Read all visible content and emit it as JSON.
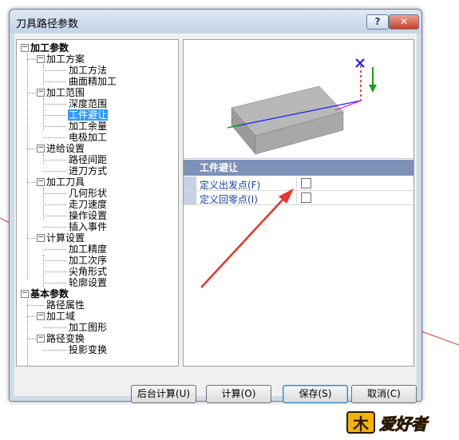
{
  "window": {
    "title": "刀具路径参数",
    "help_label": "?",
    "close_label": "✕"
  },
  "tree": {
    "items": [
      {
        "label": "加工参数",
        "level": 0,
        "bold": true,
        "expander": "⊟"
      },
      {
        "label": "加工方案",
        "level": 1,
        "expander": "⊟"
      },
      {
        "label": "加工方法",
        "level": 2
      },
      {
        "label": "曲面精加工",
        "level": 2
      },
      {
        "label": "加工范围",
        "level": 1,
        "expander": "⊟"
      },
      {
        "label": "深度范围",
        "level": 2
      },
      {
        "label": "工件避让",
        "level": 2,
        "selected": true
      },
      {
        "label": "加工余量",
        "level": 2
      },
      {
        "label": "电极加工",
        "level": 2
      },
      {
        "label": "进给设置",
        "level": 1,
        "expander": "⊟"
      },
      {
        "label": "路径间距",
        "level": 2
      },
      {
        "label": "进刀方式",
        "level": 2
      },
      {
        "label": "加工刀具",
        "level": 1,
        "expander": "⊟"
      },
      {
        "label": "几何形状",
        "level": 2
      },
      {
        "label": "走刀速度",
        "level": 2
      },
      {
        "label": "操作设置",
        "level": 2
      },
      {
        "label": "插入事件",
        "level": 2
      },
      {
        "label": "计算设置",
        "level": 1,
        "expander": "⊟"
      },
      {
        "label": "加工精度",
        "level": 2
      },
      {
        "label": "加工次序",
        "level": 2
      },
      {
        "label": "尖角形式",
        "level": 2
      },
      {
        "label": "轮廓设置",
        "level": 2
      },
      {
        "label": "基本参数",
        "level": 0,
        "bold": true,
        "expander": "⊟"
      },
      {
        "label": "路径属性",
        "level": 1
      },
      {
        "label": "加工域",
        "level": 1,
        "expander": "⊟"
      },
      {
        "label": "加工图形",
        "level": 2
      },
      {
        "label": "路径变换",
        "level": 1,
        "expander": "⊟"
      },
      {
        "label": "投影变换",
        "level": 2
      }
    ]
  },
  "properties": {
    "section_title": "工件避让",
    "rows": [
      {
        "label": "定义出发点(F)",
        "checked": false
      },
      {
        "label": "定义回零点(I)",
        "checked": false
      }
    ]
  },
  "buttons": {
    "background_calc": "后台计算(U)",
    "calc": "计算(O)",
    "save": "保存(S)",
    "cancel": "取消(C)"
  },
  "logo": {
    "text": "爱好者"
  },
  "colors": {
    "selection": "#3399ff",
    "section_header": "#7e91b9",
    "annotation_arrow": "#e8342a",
    "axis_x": "#1a1aff",
    "axis_y": "#ff00ff",
    "axis_z": "#00b000"
  }
}
